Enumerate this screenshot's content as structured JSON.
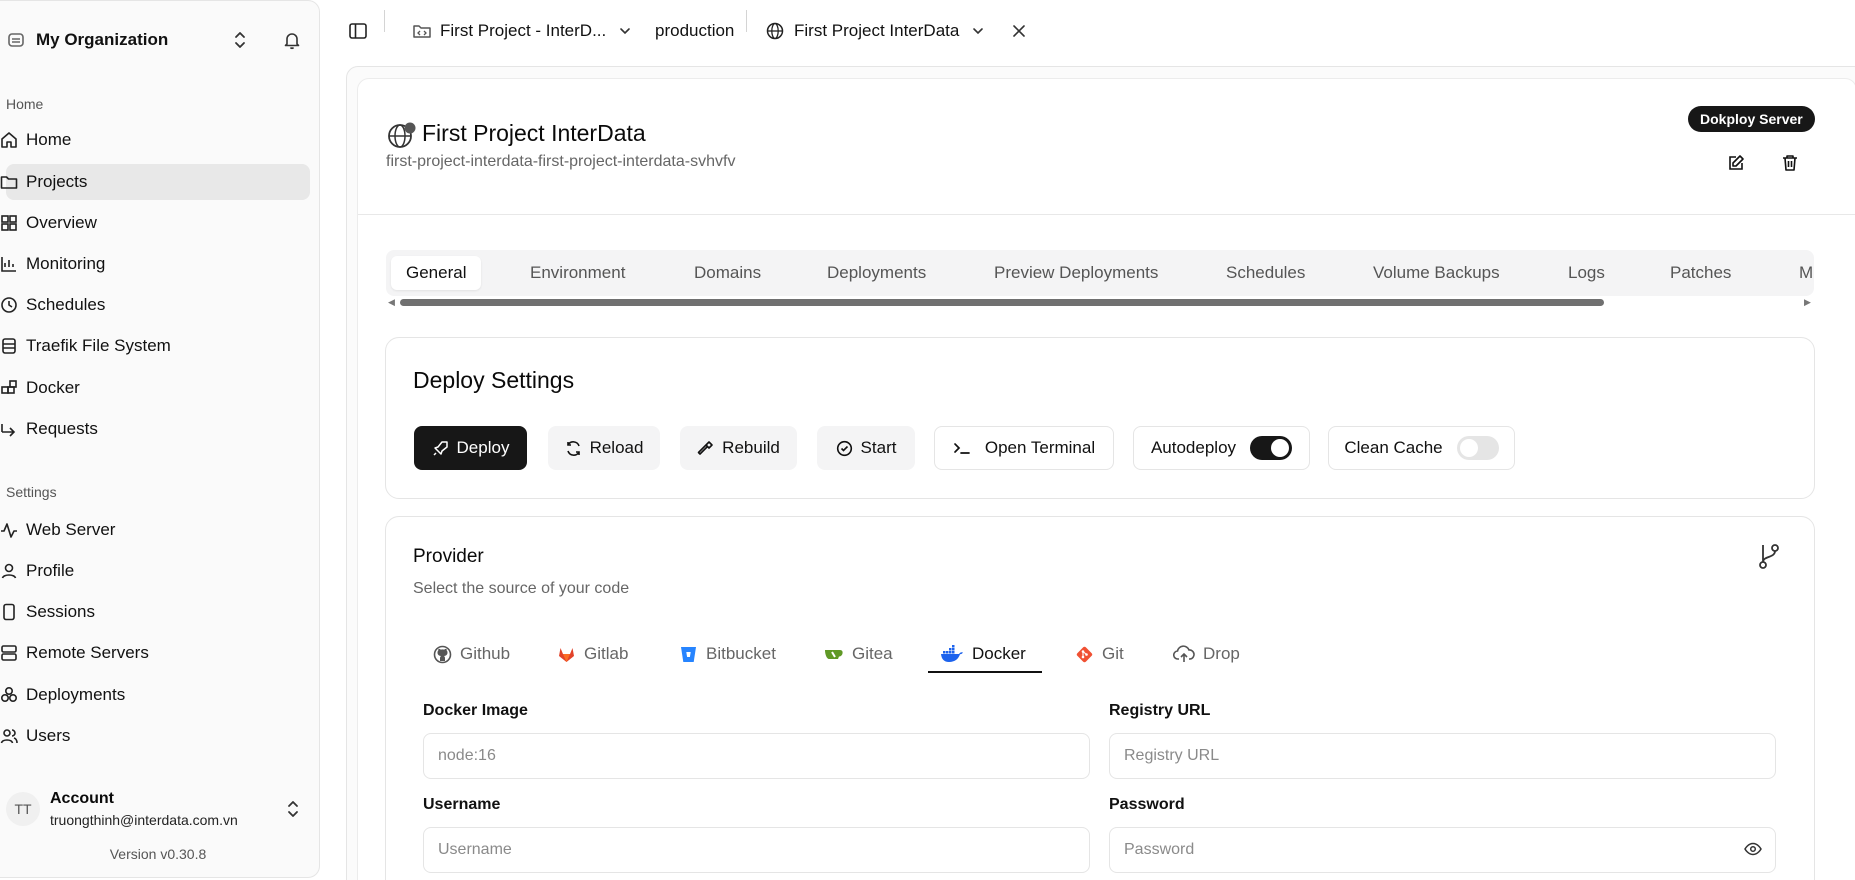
{
  "sidebar": {
    "org_name": "My Organization",
    "group_home": "Home",
    "group_settings": "Settings",
    "items": [
      {
        "label": "Home",
        "icon": "home-icon"
      },
      {
        "label": "Projects",
        "icon": "folder-icon"
      },
      {
        "label": "Overview",
        "icon": "grid-icon"
      },
      {
        "label": "Monitoring",
        "icon": "chart-icon"
      },
      {
        "label": "Schedules",
        "icon": "clock-icon"
      },
      {
        "label": "Traefik File System",
        "icon": "stack-icon"
      },
      {
        "label": "Docker",
        "icon": "blocks-icon"
      },
      {
        "label": "Requests",
        "icon": "arrow-icon"
      }
    ],
    "settings_items": [
      {
        "label": "Web Server",
        "icon": "activity-icon"
      },
      {
        "label": "Profile",
        "icon": "user-icon"
      },
      {
        "label": "Sessions",
        "icon": "tablet-icon"
      },
      {
        "label": "Remote Servers",
        "icon": "server-icon"
      },
      {
        "label": "Deployments",
        "icon": "boxes-icon"
      },
      {
        "label": "Users",
        "icon": "users-icon"
      }
    ],
    "account": {
      "initials": "TT",
      "name": "Account",
      "email": "truongthinh@interdata.com.vn"
    },
    "version": "Version v0.30.8"
  },
  "topbar": {
    "project": "First Project - InterD...",
    "environment": "production",
    "service": "First Project InterData"
  },
  "header": {
    "title": "First Project InterData",
    "subtitle": "first-project-interdata-first-project-interdata-svhvfv",
    "server_badge": "Dokploy Server"
  },
  "tabs": [
    "General",
    "Environment",
    "Domains",
    "Deployments",
    "Preview Deployments",
    "Schedules",
    "Volume Backups",
    "Logs",
    "Patches",
    "M"
  ],
  "deploy_settings": {
    "title": "Deploy Settings",
    "deploy": "Deploy",
    "reload": "Reload",
    "rebuild": "Rebuild",
    "start": "Start",
    "open_terminal": "Open Terminal",
    "autodeploy": "Autodeploy",
    "autodeploy_on": true,
    "clean_cache": "Clean Cache",
    "clean_cache_on": false
  },
  "provider": {
    "title": "Provider",
    "description": "Select the source of your code",
    "tabs": [
      "Github",
      "Gitlab",
      "Bitbucket",
      "Gitea",
      "Docker",
      "Git",
      "Drop"
    ],
    "active_tab": "Docker",
    "fields": {
      "docker_image_label": "Docker Image",
      "docker_image_placeholder": "node:16",
      "registry_url_label": "Registry URL",
      "registry_url_placeholder": "Registry URL",
      "username_label": "Username",
      "username_placeholder": "Username",
      "password_label": "Password",
      "password_placeholder": "Password"
    }
  },
  "colors": {
    "primary": "#171717",
    "gitlab": "#e2432a",
    "bitbucket": "#2684ff",
    "gitea": "#609926",
    "docker": "#1d63ed",
    "git": "#f05133"
  }
}
